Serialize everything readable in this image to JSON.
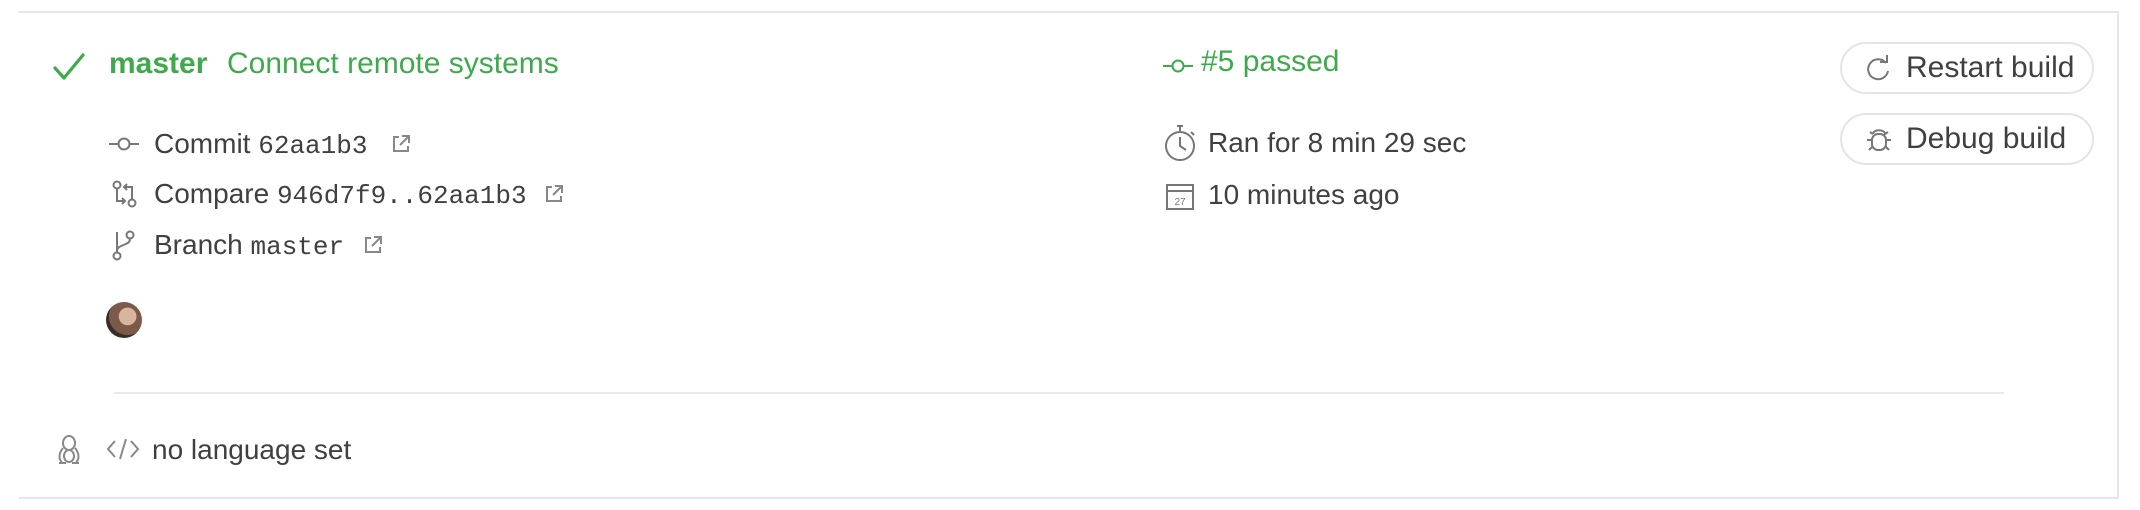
{
  "build": {
    "branch_name": "master",
    "commit_message": "Connect remote systems",
    "status_text": "#5 passed",
    "duration_text": "Ran for 8 min 29 sec",
    "time_ago": "10 minutes ago",
    "state_color": "#3eaa4c"
  },
  "details": {
    "commit_label": "Commit",
    "commit_sha": "62aa1b3",
    "compare_label": "Compare",
    "compare_range": "946d7f9..62aa1b3",
    "branch_label": "Branch",
    "branch_value": "master"
  },
  "actions": {
    "restart_label": "Restart build",
    "debug_label": "Debug build"
  },
  "footer": {
    "language_text": "no language set"
  },
  "icons": {
    "status": "check-icon",
    "commit": "commit-icon",
    "compare": "compare-icon",
    "branch": "branch-icon",
    "external": "external-link-icon",
    "duration": "stopwatch-icon",
    "calendar": "calendar-icon",
    "restart": "restart-icon",
    "debug": "debug-icon",
    "os": "linux-icon",
    "language": "code-icon"
  }
}
